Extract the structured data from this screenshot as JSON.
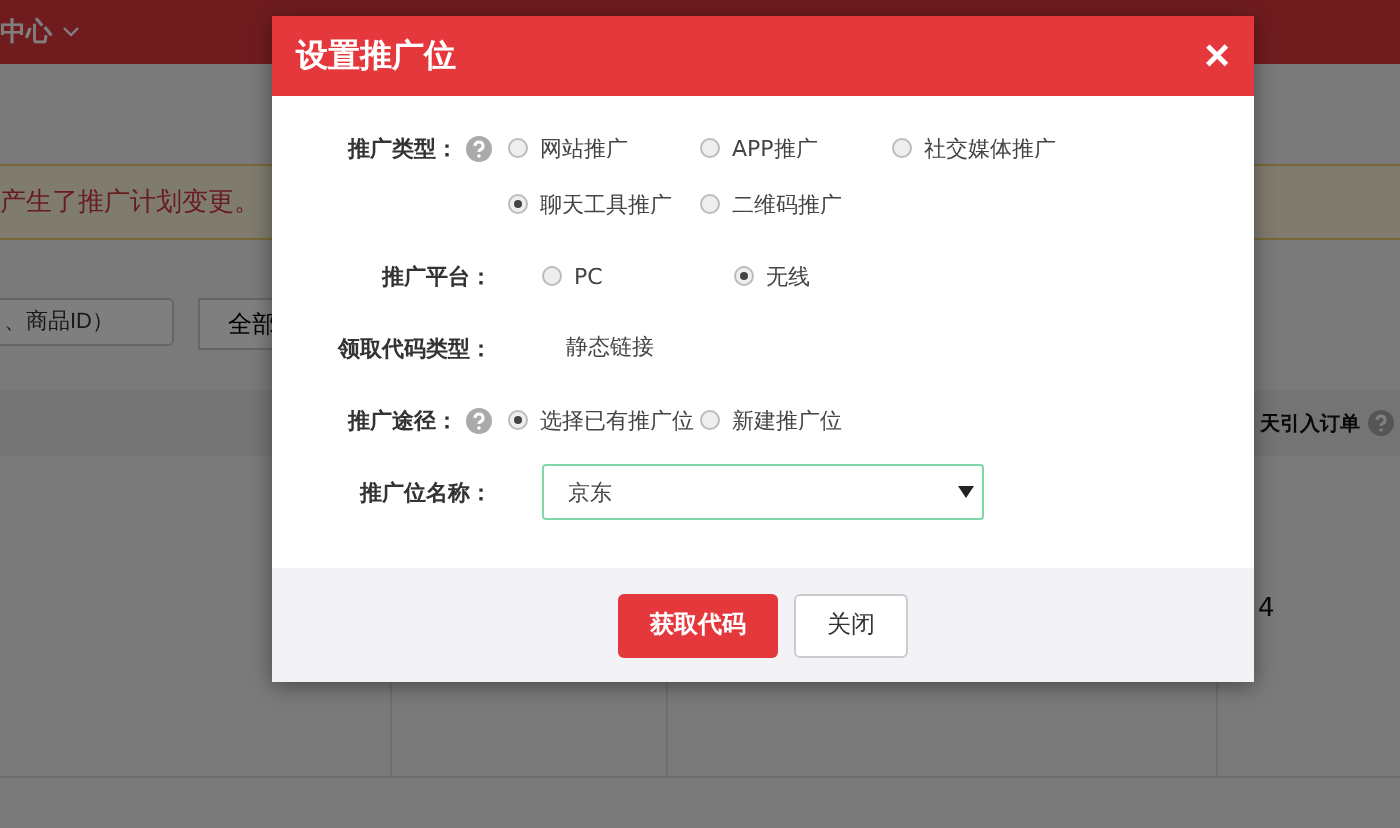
{
  "page": {
    "nav_title": "中心",
    "notice": "产生了推广计划变更。",
    "search": {
      "placeholder": "、商品ID）"
    },
    "filter_button": "全部",
    "table": {
      "column_header": "天引入订单",
      "cell": "4"
    }
  },
  "dialog": {
    "title": "设置推广位",
    "close": "×",
    "rows": [
      {
        "label": "推广类型：",
        "help": true,
        "kind": "radio",
        "options": [
          {
            "label": "网站推广",
            "selected": false
          },
          {
            "label": "APP推广",
            "selected": false
          },
          {
            "label": "社交媒体推广",
            "selected": false
          },
          {
            "label": "聊天工具推广",
            "selected": true
          },
          {
            "label": "二维码推广",
            "selected": false
          }
        ]
      },
      {
        "label": "推广平台：",
        "help": false,
        "kind": "radio",
        "options": [
          {
            "label": "PC",
            "selected": false
          },
          {
            "label": "无线",
            "selected": true
          }
        ]
      },
      {
        "label": "领取代码类型：",
        "help": false,
        "kind": "text",
        "value": "静态链接"
      },
      {
        "label": "推广途径：",
        "help": true,
        "kind": "radio",
        "options": [
          {
            "label": "选择已有推广位",
            "selected": true
          },
          {
            "label": "新建推广位",
            "selected": false
          }
        ]
      },
      {
        "label": "推广位名称：",
        "help": false,
        "kind": "select",
        "value": "京东"
      }
    ],
    "buttons": [
      {
        "label": "获取代码",
        "primary": true
      },
      {
        "label": "关闭",
        "primary": false
      }
    ]
  }
}
